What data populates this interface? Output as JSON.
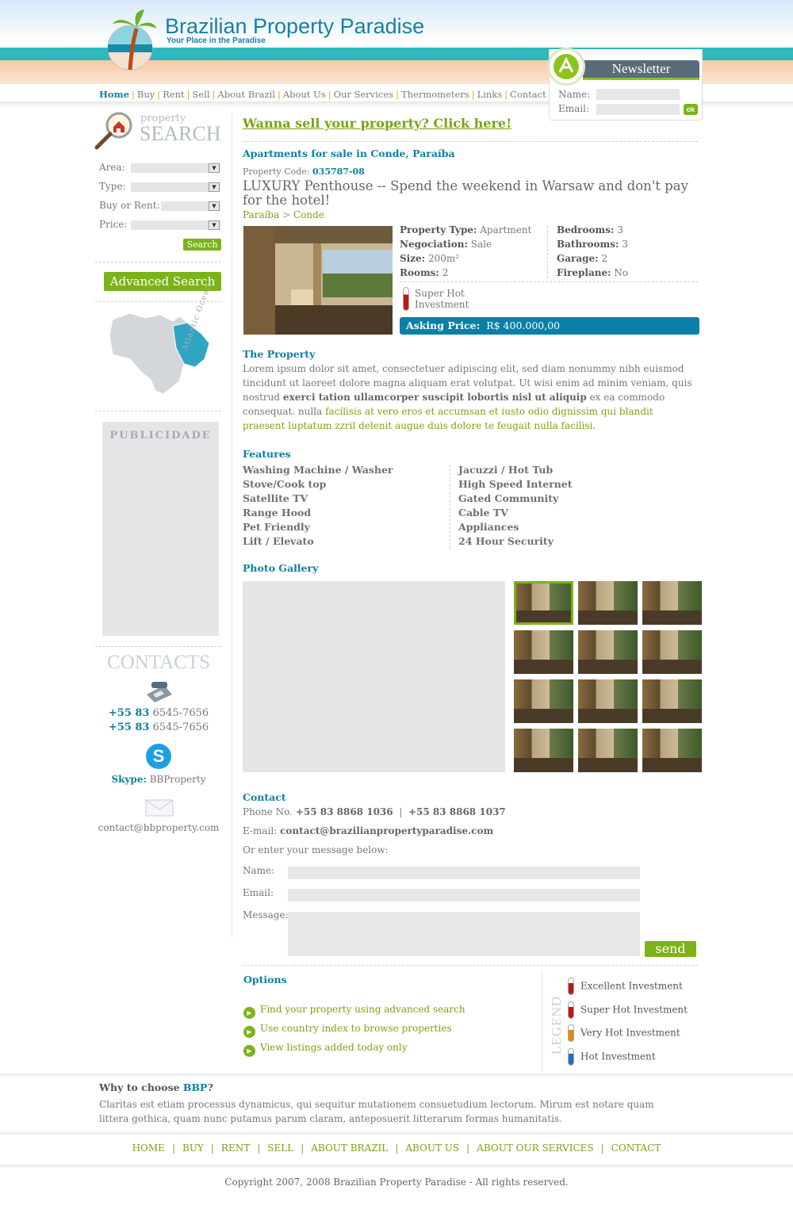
{
  "site": {
    "title": "Brazilian Property Paradise",
    "tagline": "Your Place in the Paradise"
  },
  "nav": {
    "items": [
      "Home",
      "Buy",
      "Rent",
      "Sell",
      "About Brazil",
      "About Us",
      "Our Services",
      "Thermometers",
      "Links",
      "Contact"
    ]
  },
  "newsletter": {
    "title": "Newsletter",
    "name_label": "Name:",
    "email_label": "Email:",
    "ok": "ok"
  },
  "search": {
    "small": "property",
    "big": "SEARCH",
    "area": "Area:",
    "type": "Type:",
    "buy_rent": "Buy or Rent:",
    "price": "Price:",
    "button": "Search",
    "advanced": "Advanced Search",
    "map_label": "Atlantic Ocean"
  },
  "ad": {
    "label": "PUBLICIDADE"
  },
  "contacts": {
    "title": "CONTACTS",
    "phone1_code": "+55 83",
    "phone1": "6545-7656",
    "phone2_code": "+55 83",
    "phone2": "6545-7656",
    "skype_label": "Skype:",
    "skype": "BBProperty",
    "email": "contact@bbproperty.com"
  },
  "main": {
    "sell_link": "Wanna sell your property? Click here!",
    "heading": "Apartments for sale in Conde, Paraíba",
    "code_label": "Property Code:",
    "code": "035787-08",
    "title": "LUXURY Penthouse -- Spend the weekend in Warsaw and don't pay for the hotel!",
    "crumb1": "Paraíba",
    "crumb_sep": ">",
    "crumb2": "Conde",
    "specs": {
      "type_l": "Property Type:",
      "type_v": "Apartment",
      "neg_l": "Negociation:",
      "neg_v": "Sale",
      "size_l": "Size:",
      "size_v": "200m²",
      "rooms_l": "Rooms:",
      "rooms_v": "2",
      "bed_l": "Bedrooms:",
      "bed_v": "3",
      "bath_l": "Bathrooms:",
      "bath_v": "3",
      "gar_l": "Garage:",
      "gar_v": "2",
      "fire_l": "Fireplane:",
      "fire_v": "No"
    },
    "rating": "Super Hot Investment",
    "price_label": "Asking Price:",
    "price": "R$ 400.000,00",
    "property_h": "The Property",
    "desc1": "Lorem ipsum dolor sit amet, consectetuer adipiscing elit, sed diam nonummy nibh euismod tincidunt ut laoreet dolore magna aliquam erat volutpat. Ut wisi enim ad minim veniam, quis nostrud ",
    "desc_bold": "exerci tation ullamcorper suscipit lobortis nisl ut aliquip",
    "desc2": " ex ea commodo consequat.  nulla ",
    "desc_link": "facilisis at vero eros et accumsan et iusto odio dignissim qui blandit praesent luptatum zzril delenit augue duis dolore te feugait nulla facilisi. ",
    "features_h": "Features",
    "features_left": [
      "Washing Machine / Washer",
      "Stove/Cook top",
      "Satellite TV",
      "Range Hood",
      "Pet Friendly",
      "Lift / Elevato"
    ],
    "features_right": [
      "Jacuzzi / Hot Tub",
      "High Speed Internet",
      "Gated Community",
      "Cable TV",
      "Appliances",
      "24 Hour Security"
    ],
    "gallery_h": "Photo Gallery",
    "contact_h": "Contact",
    "phone_label": "Phone No.",
    "phone_a": "+55 83 8868 1036",
    "phone_sep": "|",
    "phone_b": "+55 83 8868 1037",
    "email_label": "E-mail:",
    "email": "contact@brazilianpropertyparadise.com",
    "msg_intro": "Or enter your message below:",
    "f_name": "Name:",
    "f_email": "Email:",
    "f_msg": "Message:",
    "send": "send",
    "options_h": "Options",
    "options": [
      "Find your property using advanced search",
      "Use country index to browse properties",
      "View listings added today only"
    ],
    "legend": "LEGEND",
    "legend_items": [
      {
        "label": "Excellent Investment",
        "color": "#c01818"
      },
      {
        "label": "Super Hot Investment",
        "color": "#c01818"
      },
      {
        "label": "Very Hot Investment",
        "color": "#e08a10"
      },
      {
        "label": "Hot Investment",
        "color": "#1f6fbf"
      }
    ]
  },
  "why": {
    "title_a": "Why to choose ",
    "title_b": "BBP",
    "title_c": "?",
    "text": "Claritas est etiam processus dynamicus, qui sequitur mutationem consuetudium lectorum. Mirum est notare quam littera gothica, quam nunc putamus parum claram, anteposuerit litterarum formas humanitatis."
  },
  "footer_nav": [
    "HOME",
    "BUY",
    "RENT",
    "SELL",
    "ABOUT BRAZIL",
    "ABOUT US",
    "ABOUT OUR SERVICES",
    "CONTACT"
  ],
  "copyright": "Copyright 2007, 2008 Brazilian Property Paradise - All rights reserved."
}
